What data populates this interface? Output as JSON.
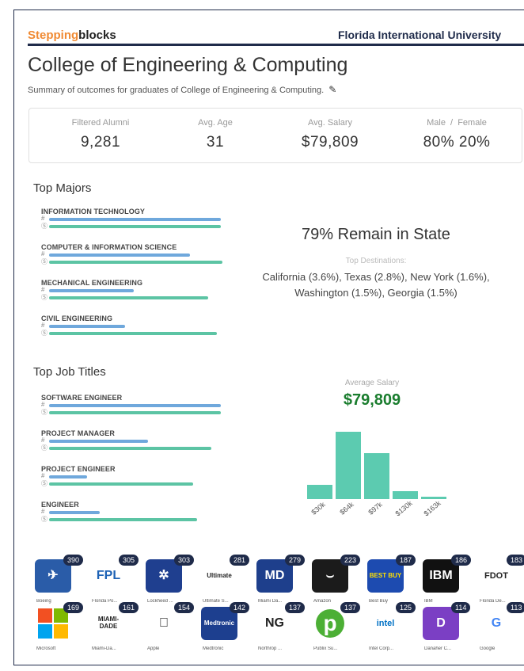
{
  "brand": {
    "part1": "Stepping",
    "part2": "blocks"
  },
  "university": "Florida International University",
  "title": "College of Engineering & Computing",
  "subtitle": "Summary of outcomes for graduates of College of Engineering & Computing.",
  "stats": [
    {
      "label": "Filtered Alumni",
      "value": "9,281"
    },
    {
      "label": "Avg. Age",
      "value": "31"
    },
    {
      "label": "Avg. Salary",
      "value": "$79,809"
    },
    {
      "label": "Male  /  Female",
      "value": "80% 20%"
    }
  ],
  "top_majors": {
    "heading": "Top Majors",
    "count_symbol": "#",
    "salary_symbol": "$",
    "items": [
      {
        "name": "INFORMATION TECHNOLOGY",
        "count_frac": 0.95,
        "salary_frac": 0.95
      },
      {
        "name": "COMPUTER & INFORMATION SCIENCE",
        "count_frac": 0.78,
        "salary_frac": 0.96
      },
      {
        "name": "MECHANICAL ENGINEERING",
        "count_frac": 0.47,
        "salary_frac": 0.88
      },
      {
        "name": "CIVIL ENGINEERING",
        "count_frac": 0.42,
        "salary_frac": 0.93
      }
    ]
  },
  "remain": {
    "headline": "79% Remain in State",
    "dest_label": "Top Destinations:",
    "destinations": "California (3.6%), Texas (2.8%), New York (1.6%), Washington (1.5%), Georgia (1.5%)"
  },
  "top_jobs": {
    "heading": "Top Job Titles",
    "items": [
      {
        "name": "SOFTWARE ENGINEER",
        "count_frac": 0.95,
        "salary_frac": 0.95
      },
      {
        "name": "PROJECT MANAGER",
        "count_frac": 0.55,
        "salary_frac": 0.9
      },
      {
        "name": "PROJECT ENGINEER",
        "count_frac": 0.21,
        "salary_frac": 0.8
      },
      {
        "name": "ENGINEER",
        "count_frac": 0.28,
        "salary_frac": 0.82
      }
    ]
  },
  "salary_chart": {
    "label": "Average Salary",
    "value": "$79,809",
    "color": "#5ccbb0",
    "bins": [
      0.18,
      0.85,
      0.58,
      0.1,
      0.03
    ],
    "tick_labels": [
      "$30k",
      "$64k",
      "$97k",
      "$130k",
      "$163k"
    ]
  },
  "employers": [
    {
      "name": "Boeing",
      "count": "390",
      "bg": "#2a5ca8",
      "icon": "boeing-icon",
      "mark": "✈"
    },
    {
      "name": "Florida Po...",
      "count": "305",
      "bg": "#ffffff",
      "icon": "fpl-icon",
      "mark": "FPL"
    },
    {
      "name": "Lockheed ...",
      "count": "303",
      "bg": "#1f3f8f",
      "icon": "lockheed-icon",
      "mark": "✲"
    },
    {
      "name": "Ultimate S...",
      "count": "281",
      "bg": "#ffffff",
      "icon": "ultimate-software-icon",
      "mark": "Ultimate"
    },
    {
      "name": "Miami Da...",
      "count": "279",
      "bg": "#1e3f8c",
      "icon": "miami-dade-college-icon",
      "mark": "MD"
    },
    {
      "name": "Amazon",
      "count": "223",
      "bg": "#1b1b1b",
      "icon": "amazon-icon",
      "mark": "⌣"
    },
    {
      "name": "Best Buy",
      "count": "187",
      "bg": "#1d4bb0",
      "icon": "bestbuy-icon",
      "mark": "BEST BUY"
    },
    {
      "name": "IBM",
      "count": "186",
      "bg": "#111111",
      "icon": "ibm-icon",
      "mark": "IBM"
    },
    {
      "name": "Florida De...",
      "count": "183",
      "bg": "#ffffff",
      "icon": "fdot-icon",
      "mark": "FDOT"
    },
    {
      "name": "Microsoft",
      "count": "169",
      "bg": "#ffffff",
      "icon": "microsoft-icon",
      "mark": ""
    },
    {
      "name": "Miami-Da...",
      "count": "161",
      "bg": "#ffffff",
      "icon": "miami-dade-county-icon",
      "mark": "MIAMI-DADE"
    },
    {
      "name": "Apple",
      "count": "154",
      "bg": "#ffffff",
      "icon": "apple-icon",
      "mark": ""
    },
    {
      "name": "Medtronic",
      "count": "142",
      "bg": "#1d3f8f",
      "icon": "medtronic-icon",
      "mark": "Medtronic"
    },
    {
      "name": "Northrop ...",
      "count": "137",
      "bg": "#ffffff",
      "icon": "northrop-icon",
      "mark": "NG"
    },
    {
      "name": "Publix Su...",
      "count": "137",
      "bg": "#ffffff",
      "icon": "publix-icon",
      "mark": "p"
    },
    {
      "name": "Intel Corp...",
      "count": "125",
      "bg": "#ffffff",
      "icon": "intel-icon",
      "mark": "intel"
    },
    {
      "name": "Danaher C...",
      "count": "114",
      "bg": "#7b3fc4",
      "icon": "danaher-icon",
      "mark": "D"
    },
    {
      "name": "Google",
      "count": "113",
      "bg": "#ffffff",
      "icon": "google-icon",
      "mark": "G"
    }
  ]
}
